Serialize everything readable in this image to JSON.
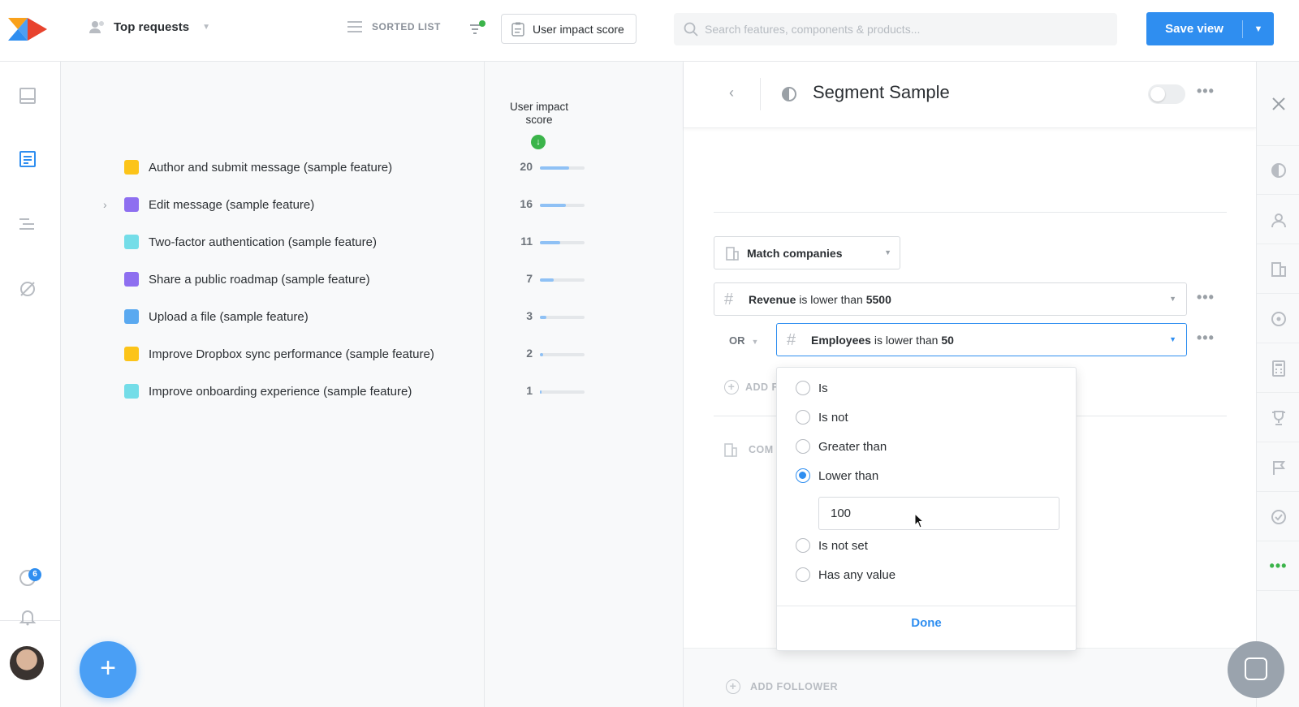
{
  "header": {
    "view_name": "Top requests",
    "sorted_label": "SORTED LIST",
    "impact_button": "User impact score",
    "search_placeholder": "Search features, components & products...",
    "save_label": "Save view"
  },
  "rail": {
    "notification_count": "6"
  },
  "score_header": "User impact score",
  "features": [
    {
      "name": "Author and submit message (sample feature)",
      "color": "#fcc419",
      "score": "20",
      "fill": 0.65,
      "expandable": false
    },
    {
      "name": "Edit message (sample feature)",
      "color": "#8e6ff0",
      "score": "16",
      "fill": 0.58,
      "expandable": true
    },
    {
      "name": "Two-factor authentication (sample feature)",
      "color": "#74dde8",
      "score": "11",
      "fill": 0.45,
      "expandable": false
    },
    {
      "name": "Share a public roadmap (sample feature)",
      "color": "#8e6ff0",
      "score": "7",
      "fill": 0.3,
      "expandable": false
    },
    {
      "name": "Upload a file (sample feature)",
      "color": "#5aa9f0",
      "score": "3",
      "fill": 0.15,
      "expandable": false
    },
    {
      "name": "Improve Dropbox sync performance (sample feature)",
      "color": "#fcc419",
      "score": "2",
      "fill": 0.08,
      "expandable": false
    },
    {
      "name": "Improve onboarding experience (sample feature)",
      "color": "#74dde8",
      "score": "1",
      "fill": 0.04,
      "expandable": false
    }
  ],
  "detail": {
    "title": "Segment Sample",
    "match_label": "Match companies",
    "conditions": [
      {
        "field": "Revenue",
        "op": "is lower than",
        "value": "5500"
      },
      {
        "field": "Employees",
        "op": "is lower than",
        "value": "50"
      }
    ],
    "or_label": "OR",
    "add_label": "ADD F",
    "com_label": "COM",
    "follower_label": "ADD FOLLOWER"
  },
  "popup": {
    "options": [
      "Is",
      "Is not",
      "Greater than",
      "Lower than",
      "Is not set",
      "Has any value"
    ],
    "selected": "Lower than",
    "value": "100",
    "done_label": "Done"
  },
  "colors": {
    "accent": "#2f8ef0",
    "green": "#3bb44a"
  }
}
